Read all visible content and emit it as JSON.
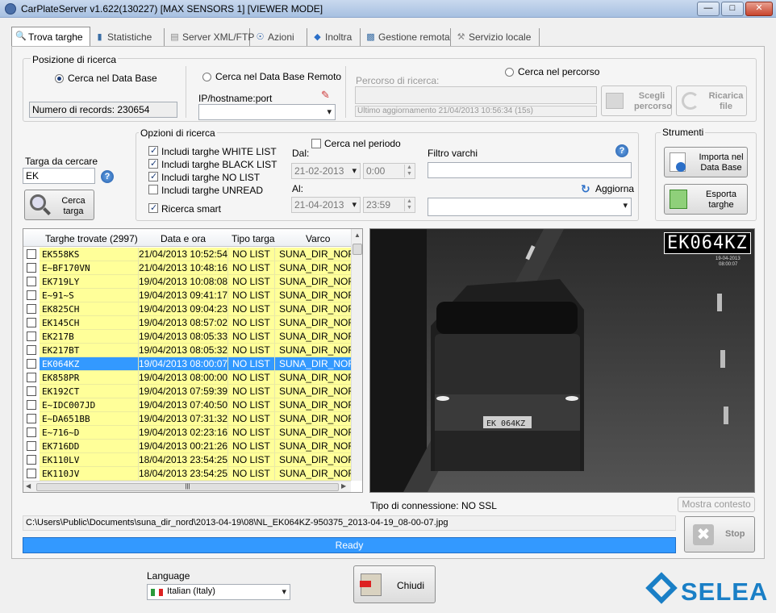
{
  "window": {
    "title": "CarPlateServer v1.622(130227) [MAX SENSORS 1] [VIEWER MODE]"
  },
  "tabs": [
    {
      "label": "Trova targhe",
      "icon": "search-icon"
    },
    {
      "label": "Statistiche",
      "icon": "bar-chart-icon"
    },
    {
      "label": "Server XML/FTP",
      "icon": "server-icon"
    },
    {
      "label": "Azioni",
      "icon": "actions-icon"
    },
    {
      "label": "Inoltra",
      "icon": "diamond-icon"
    },
    {
      "label": "Gestione remota",
      "icon": "remote-icon"
    },
    {
      "label": "Servizio locale",
      "icon": "wrench-icon"
    }
  ],
  "search_position": {
    "group_label": "Posizione di ricerca",
    "local_db_label": "Cerca nel Data Base",
    "records_label": "Numero di records: 230654",
    "remote_db_label": "Cerca nel Data Base Remoto",
    "host_label": "IP/hostname:port",
    "host_value": "",
    "path_radio_label": "Cerca nel percorso",
    "path_label": "Percorso di ricerca:",
    "path_value": "",
    "last_update": "Ultimo aggiornamento 21/04/2013 10:56:34 (15s)",
    "choose_path_label": "Scegli percorso",
    "reload_file_label": "Ricarica file"
  },
  "plate_search": {
    "label": "Targa da cercare",
    "value": "EK",
    "button_label": "Cerca targa"
  },
  "options": {
    "group_label": "Opzioni di ricerca",
    "checkboxes": [
      {
        "label": "Includi targhe WHITE LIST",
        "checked": true
      },
      {
        "label": "Includi targhe BLACK LIST",
        "checked": true
      },
      {
        "label": "Includi targhe NO LIST",
        "checked": true
      },
      {
        "label": "Includi targhe UNREAD",
        "checked": false
      }
    ],
    "smart_label": "Ricerca smart",
    "smart_checked": true,
    "period_label": "Cerca nel periodo",
    "from_label": "Dal:",
    "from_date": "21-02-2013",
    "from_time": "0:00",
    "to_label": "Al:",
    "to_date": "21-04-2013",
    "to_time": "23:59",
    "gates_filter_label": "Filtro varchi",
    "gates_filter_value": "",
    "refresh_label": "Aggiorna",
    "gate_select_value": ""
  },
  "tools": {
    "group_label": "Strumenti",
    "import_label": "Importa nel Data Base",
    "export_label": "Esporta targhe"
  },
  "grid": {
    "headers": [
      "Targhe trovate (2997)",
      "Data e ora",
      "Tipo targa",
      "Varco"
    ],
    "selected_index": 9,
    "rows": [
      [
        "EK558KS",
        "21/04/2013 10:52:54",
        "NO LIST",
        "SUNA_DIR_NOR"
      ],
      [
        "E~BF170VN",
        "21/04/2013 10:48:16",
        "NO LIST",
        "SUNA_DIR_NOR"
      ],
      [
        "EK719LY",
        "19/04/2013 10:08:08",
        "NO LIST",
        "SUNA_DIR_NOR"
      ],
      [
        "E~91~S",
        "19/04/2013 09:41:17",
        "NO LIST",
        "SUNA_DIR_NOR"
      ],
      [
        "EK825CH",
        "19/04/2013 09:04:23",
        "NO LIST",
        "SUNA_DIR_NOR"
      ],
      [
        "EK145CH",
        "19/04/2013 08:57:02",
        "NO LIST",
        "SUNA_DIR_NOR"
      ],
      [
        "EK217B",
        "19/04/2013 08:05:33",
        "NO LIST",
        "SUNA_DIR_NOR"
      ],
      [
        "EK217BT",
        "19/04/2013 08:05:32",
        "NO LIST",
        "SUNA_DIR_NOR"
      ],
      [
        "EK064KZ",
        "19/04/2013 08:00:07",
        "NO LIST",
        "SUNA_DIR_NOR"
      ],
      [
        "EK858PR",
        "19/04/2013 08:00:00",
        "NO LIST",
        "SUNA_DIR_NOR"
      ],
      [
        "EK192CT",
        "19/04/2013 07:59:39",
        "NO LIST",
        "SUNA_DIR_NOR"
      ],
      [
        "E~IDC007JD",
        "19/04/2013 07:40:50",
        "NO LIST",
        "SUNA_DIR_NOR"
      ],
      [
        "E~DA651BB",
        "19/04/2013 07:31:32",
        "NO LIST",
        "SUNA_DIR_NOR"
      ],
      [
        "E~716~D",
        "19/04/2013 02:23:16",
        "NO LIST",
        "SUNA_DIR_NOR"
      ],
      [
        "EK716DD",
        "19/04/2013 00:21:26",
        "NO LIST",
        "SUNA_DIR_NOR"
      ],
      [
        "EK110LV",
        "18/04/2013 23:54:25",
        "NO LIST",
        "SUNA_DIR_NOR"
      ],
      [
        "EK110JV",
        "18/04/2013 23:54:25",
        "NO LIST",
        "SUNA_DIR_NOR"
      ]
    ]
  },
  "camera": {
    "plate_overlay": "EK064KZ",
    "stamp_date": "19-04-2013",
    "stamp_time": "08:00:07",
    "vehicle_plate": "EK 064KZ"
  },
  "connection_label": "Tipo di connessione: NO SSL",
  "show_context_label": "Mostra contesto",
  "file_path": "C:\\Users\\Public\\Documents\\suna_dir_nord\\2013-04-19\\08\\NL_EK064KZ-950375_2013-04-19_08-00-07.jpg",
  "status": "Ready",
  "stop_label": "Stop",
  "language": {
    "label": "Language",
    "value": "Italian (Italy)"
  },
  "close_label": "Chiudi",
  "brand": "SELEA",
  "colors": {
    "selection": "#3399ff",
    "row_highlight": "#ffff99",
    "progress": "#3399ff",
    "brand": "#1a7fc6"
  }
}
